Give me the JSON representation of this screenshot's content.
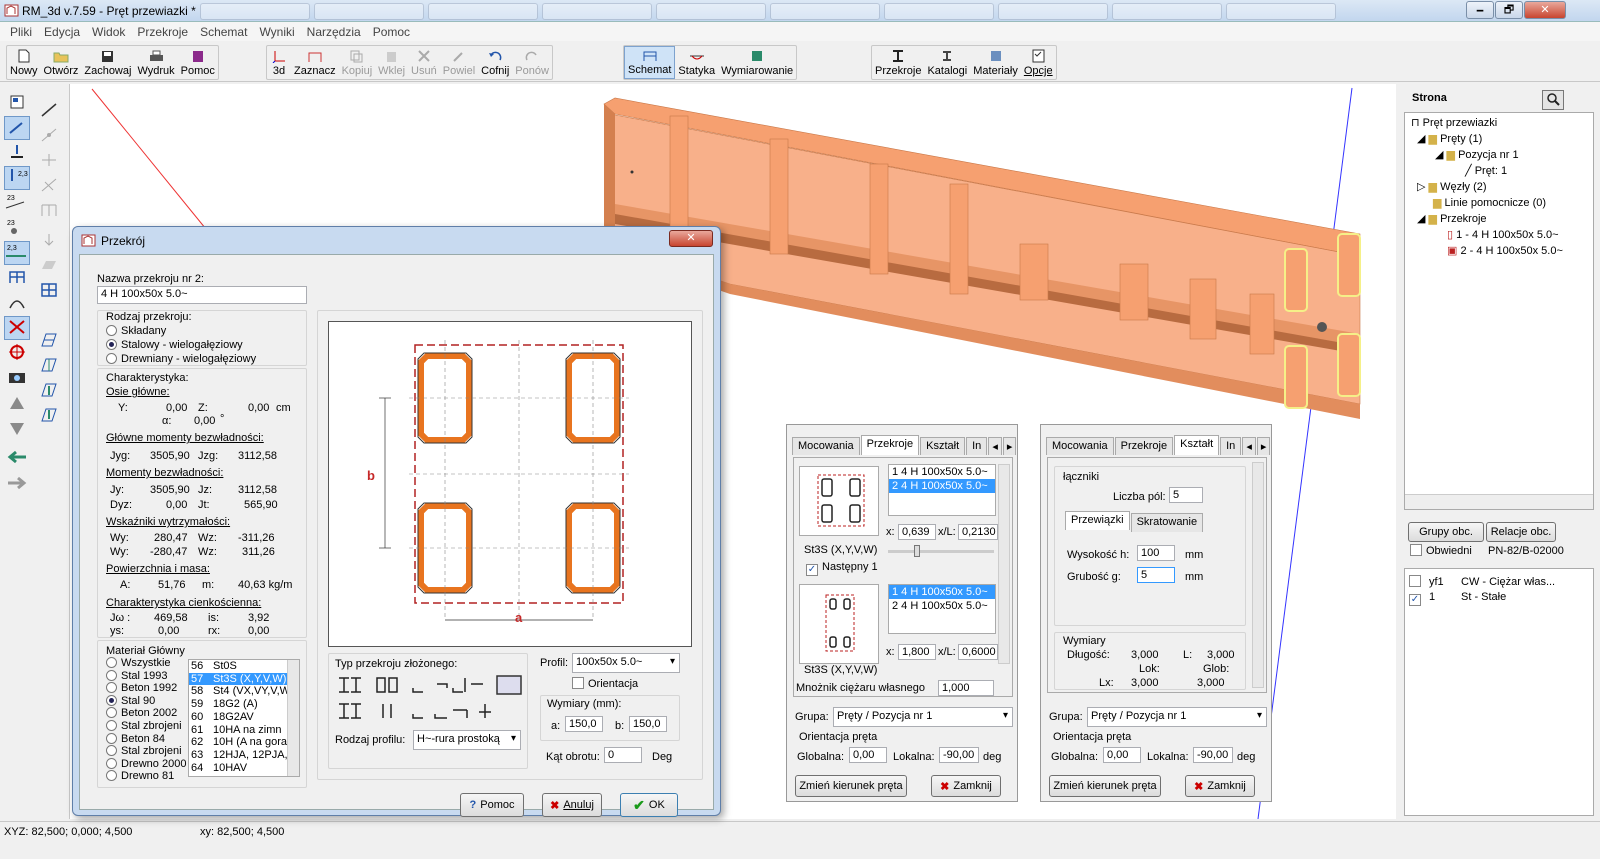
{
  "window": {
    "title": "RM_3d v.7.59 - Pręt przewiazki *",
    "minimize": "🗕",
    "maximize": "🗗",
    "close": "✕"
  },
  "menu": [
    "Pliki",
    "Edycja",
    "Widok",
    "Przekroje",
    "Schemat",
    "Wyniki",
    "Narzędzia",
    "Pomoc"
  ],
  "toolbar": {
    "file": [
      "Nowy",
      "Otwórz",
      "Zachowaj",
      "Wydruk",
      "Pomoc"
    ],
    "edit": [
      "3d",
      "Zaznacz",
      "Kopiuj",
      "Wklej",
      "Usuń",
      "Powiel",
      "Cofnij",
      "Ponów"
    ],
    "mode": [
      "Schemat",
      "Statyka",
      "Wymiarowanie"
    ],
    "data": [
      "Przekroje",
      "Katalogi",
      "Materiały",
      "Opcje"
    ]
  },
  "left_tools": {
    "label_23a": "2,3",
    "label_23b": "23",
    "label_23c": "23",
    "label_23d": "2,3"
  },
  "right_panel": {
    "header": "Strona",
    "tree": [
      {
        "label": "Pręt przewiazki"
      },
      {
        "label": "Pręty (1)"
      },
      {
        "label": "Pozycja nr 1"
      },
      {
        "label": "Pręt: 1"
      },
      {
        "label": "Węzły (2)"
      },
      {
        "label": "Linie pomocnicze (0)"
      },
      {
        "label": "Przekroje"
      },
      {
        "label": "1 - 4 H 100x50x 5.0~"
      },
      {
        "label": "2 - 4 H 100x50x 5.0~"
      }
    ],
    "btn_groups": "Grupy obc.",
    "btn_relations": "Relacje obc.",
    "envelope_label": "Obwiedni",
    "norm": "PN-82/B-02000",
    "loads": [
      {
        "code": "yf1",
        "name": "CW - Ciężar włas...",
        "checked": false
      },
      {
        "code": "1",
        "name": "St - Stałe",
        "checked": true
      }
    ]
  },
  "status": {
    "xyz": "XYZ: 82,500; 0,000; 4,500",
    "xy": "xy: 82,500; 4,500"
  },
  "dialog": {
    "title": "Przekrój",
    "name_label": "Nazwa przekroju nr 2:",
    "name_value": "4 H 100x50x 5.0~",
    "kind_title": "Rodzaj przekroju:",
    "kinds": [
      "Składany",
      "Stalowy - wielogałęziowy",
      "Drewniany - wielogałęziowy"
    ],
    "kind_selected": 1,
    "char_title": "Charakterystyka:",
    "axes_title": "Osie główne:",
    "Y_label": "Y:",
    "Y": "0,00",
    "Z_label": "Z:",
    "Z": "0,00",
    "unit_cm": "cm",
    "alpha_label": "α:",
    "alpha": "0,00",
    "deg": "°",
    "main_inertia_title": "Główne momenty bezwładności:",
    "Jyg_label": "Jyg:",
    "Jyg": "3505,90",
    "Jzg_label": "Jzg:",
    "Jzg": "3112,58",
    "inertia_title": "Momenty bezwładności:",
    "Jy_label": "Jy:",
    "Jy": "3505,90",
    "Jz_label": "Jz:",
    "Jz": "3112,58",
    "Dyz_label": "Dyz:",
    "Dyz": "0,00",
    "Jt_label": "Jt:",
    "Jt": "565,90",
    "strength_title": "Wskaźniki wytrzymałości:",
    "Wy1_label": "Wy:",
    "Wy1": "280,47",
    "Wz1_label": "Wz:",
    "Wz1": "-311,26",
    "Wy2_label": "Wy:",
    "Wy2": "-280,47",
    "Wz2_label": "Wz:",
    "Wz2": "311,26",
    "area_title": "Powierzchnia i masa:",
    "A_label": "A:",
    "A": "51,76",
    "m_label": "m:",
    "m": "40,63 kg/m",
    "thin_title": "Charakterystyka cienkościenna:",
    "Jw_label": "Jω :",
    "Jw": "469,58",
    "is_label": "is:",
    "is": "3,92",
    "ys_label": "ys:",
    "ys": "0,00",
    "rx_label": "rx:",
    "rx": "0,00",
    "material_title": "Materiał Główny",
    "materials": [
      "Wszystkie",
      "Stal 1993",
      "Beton 1992",
      "Stal 90",
      "Beton 2002",
      "Stal zbrojeni",
      "Beton 84",
      "Stal zbrojeni",
      "Drewno 2000",
      "Drewno 81"
    ],
    "material_selected": 3,
    "steels": [
      {
        "n": "56",
        "v": "St0S"
      },
      {
        "n": "57",
        "v": "St3S (X,Y,V,W)"
      },
      {
        "n": "58",
        "v": "St4 (VX,VY,V,W"
      },
      {
        "n": "59",
        "v": "18G2 (A)"
      },
      {
        "n": "60",
        "v": "18G2AV"
      },
      {
        "n": "61",
        "v": "10HA  na zimn"
      },
      {
        "n": "62",
        "v": "10H (A na gora"
      },
      {
        "n": "63",
        "v": "12HJA, 12PJA,"
      },
      {
        "n": "64",
        "v": "10HAV"
      }
    ],
    "steel_selected": 1,
    "dim_a": "a",
    "dim_b": "b",
    "composite_type_label": "Typ przekroju złożonego:",
    "profile_type_label": "Rodzaj profilu:",
    "profile_type": "H~-rura prostoką",
    "profile_label": "Profil:",
    "profile": "100x50x 5.0~",
    "orientation_label": "Orientacja",
    "dims_title": "Wymiary (mm):",
    "a_label": "a:",
    "a": "150,0",
    "b_label": "b:",
    "b": "150,0",
    "angle_label": "Kąt obrotu:",
    "angle": "0",
    "angle_unit": "Deg",
    "help": "Pomoc",
    "cancel": "Anuluj",
    "ok": "OK"
  },
  "panel1": {
    "tabs": [
      "Mocowania",
      "Przekroje",
      "Kształt",
      "In"
    ],
    "active_tab": 1,
    "list1": [
      "1  4 H 100x50x 5.0~",
      "2  4 H 100x50x 5.0~"
    ],
    "list1_sel": 1,
    "x_label": "x:",
    "x": "0,639",
    "xl_label": "x/L:",
    "xl": "0,2130",
    "material": "St3S (X,Y,V,W)",
    "next_label": "Następny 1",
    "list2": [
      "1  4 H 100x50x 5.0~",
      "2  4 H 100x50x 5.0~"
    ],
    "list2_sel": 0,
    "x2": "1,800",
    "xl2": "0,6000",
    "material2": "St3S (X,Y,V,W)",
    "weight_label": "Mnożnik ciężaru własnego",
    "weight": "1,000",
    "group_label": "Grupa:",
    "group": "Pręty / Pozycja nr 1",
    "orient_title": "Orientacja pręta",
    "global_label": "Globalna:",
    "global": "0,00",
    "local_label": "Lokalna:",
    "local": "-90,00",
    "deg": "deg",
    "change_dir": "Zmień kierunek pręta",
    "close": "Zamknij"
  },
  "panel2": {
    "tabs": [
      "Mocowania",
      "Przekroje",
      "Kształt",
      "In"
    ],
    "active_tab": 2,
    "connectors_title": "łączniki",
    "fields_label": "Liczba pól:",
    "fields": "5",
    "subtabs": [
      "Przewiązki",
      "Skratowanie"
    ],
    "height_label": "Wysokość h:",
    "height": "100",
    "thick_label": "Grubość  g:",
    "thick": "5",
    "mm": "mm",
    "dims_title": "Wymiary",
    "len_label": "Długość:",
    "len": "3,000",
    "L_label": "L:",
    "L": "3,000",
    "lok_label": "Lok:",
    "glob_label": "Glob:",
    "lx_label": "Lx:",
    "lx": "3,000",
    "lx2": "3,000",
    "group_label": "Grupa:",
    "group": "Pręty / Pozycja nr 1",
    "orient_title": "Orientacja pręta",
    "global_label": "Globalna:",
    "global": "0,00",
    "local_label": "Lokalna:",
    "local": "-90,00",
    "deg": "deg",
    "change_dir": "Zmień kierunek pręta",
    "close": "Zamknij"
  },
  "colors": {
    "beam": "#f6a070",
    "beam_dark": "#d4804f",
    "section": "#e8741f",
    "selection": "#3399ff",
    "dash": "#b22222",
    "accent": "#cfe3f7"
  }
}
